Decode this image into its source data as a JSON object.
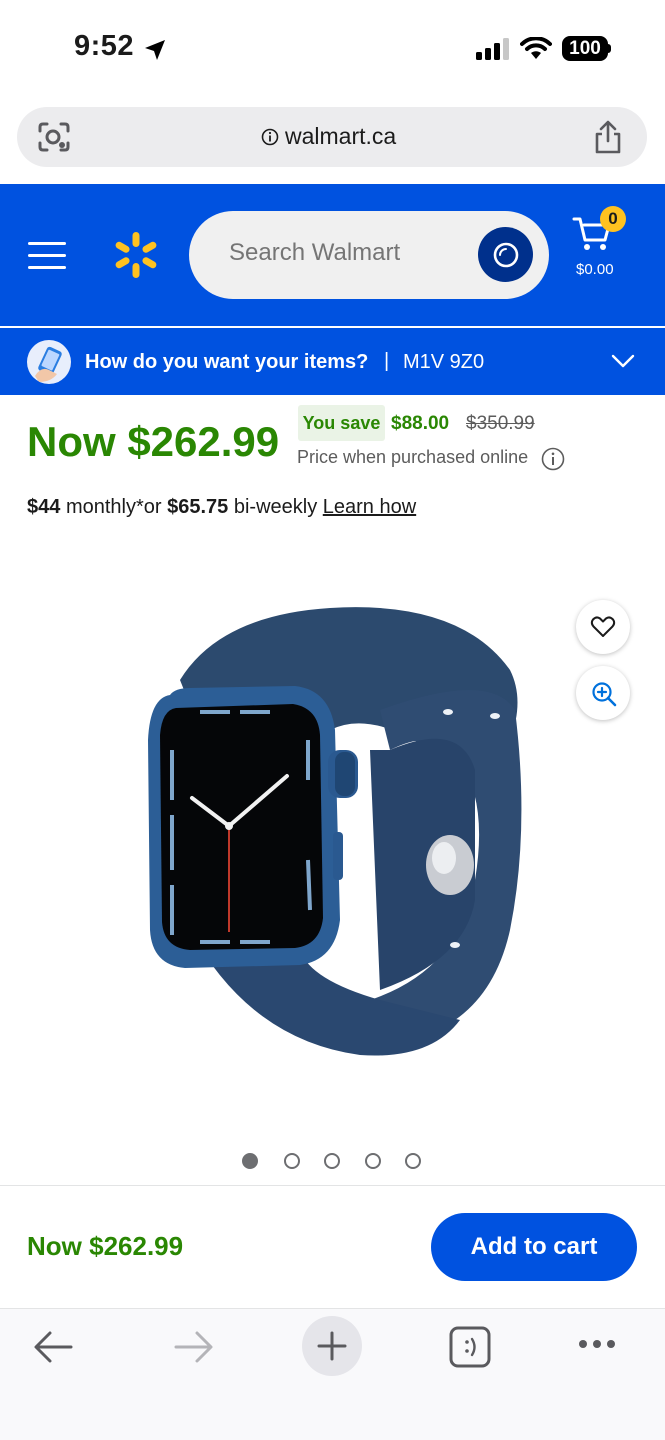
{
  "status_bar": {
    "time": "9:52",
    "battery": "100"
  },
  "browser": {
    "url": "walmart.ca"
  },
  "header": {
    "search_placeholder": "Search Walmart",
    "cart_count": "0",
    "cart_total": "$0.00",
    "brand_color": "#0052e0",
    "spark_color": "#ffc220"
  },
  "delivery": {
    "question": "How do you want your items?",
    "separator": "|",
    "postal_code": "M1V 9Z0"
  },
  "pricing": {
    "now_price": "Now $262.99",
    "you_save_label": "You save",
    "save_amount": "$88.00",
    "was_price": "$350.99",
    "price_note": "Price when purchased online",
    "price_color": "#2a8703"
  },
  "financing": {
    "monthly_amount": "$44",
    "monthly_text": "monthly*or",
    "biweekly_amount": "$65.75",
    "biweekly_text": "bi-weekly",
    "learn_how": "Learn how"
  },
  "carousel": {
    "total": 5,
    "active_index": 0
  },
  "sticky_bar": {
    "price": "Now $262.99",
    "add_to_cart": "Add to cart"
  },
  "toolbar": {
    "items": [
      "back-icon",
      "forward-icon",
      "new-tab-icon",
      "tabs-icon",
      "more-icon"
    ]
  }
}
